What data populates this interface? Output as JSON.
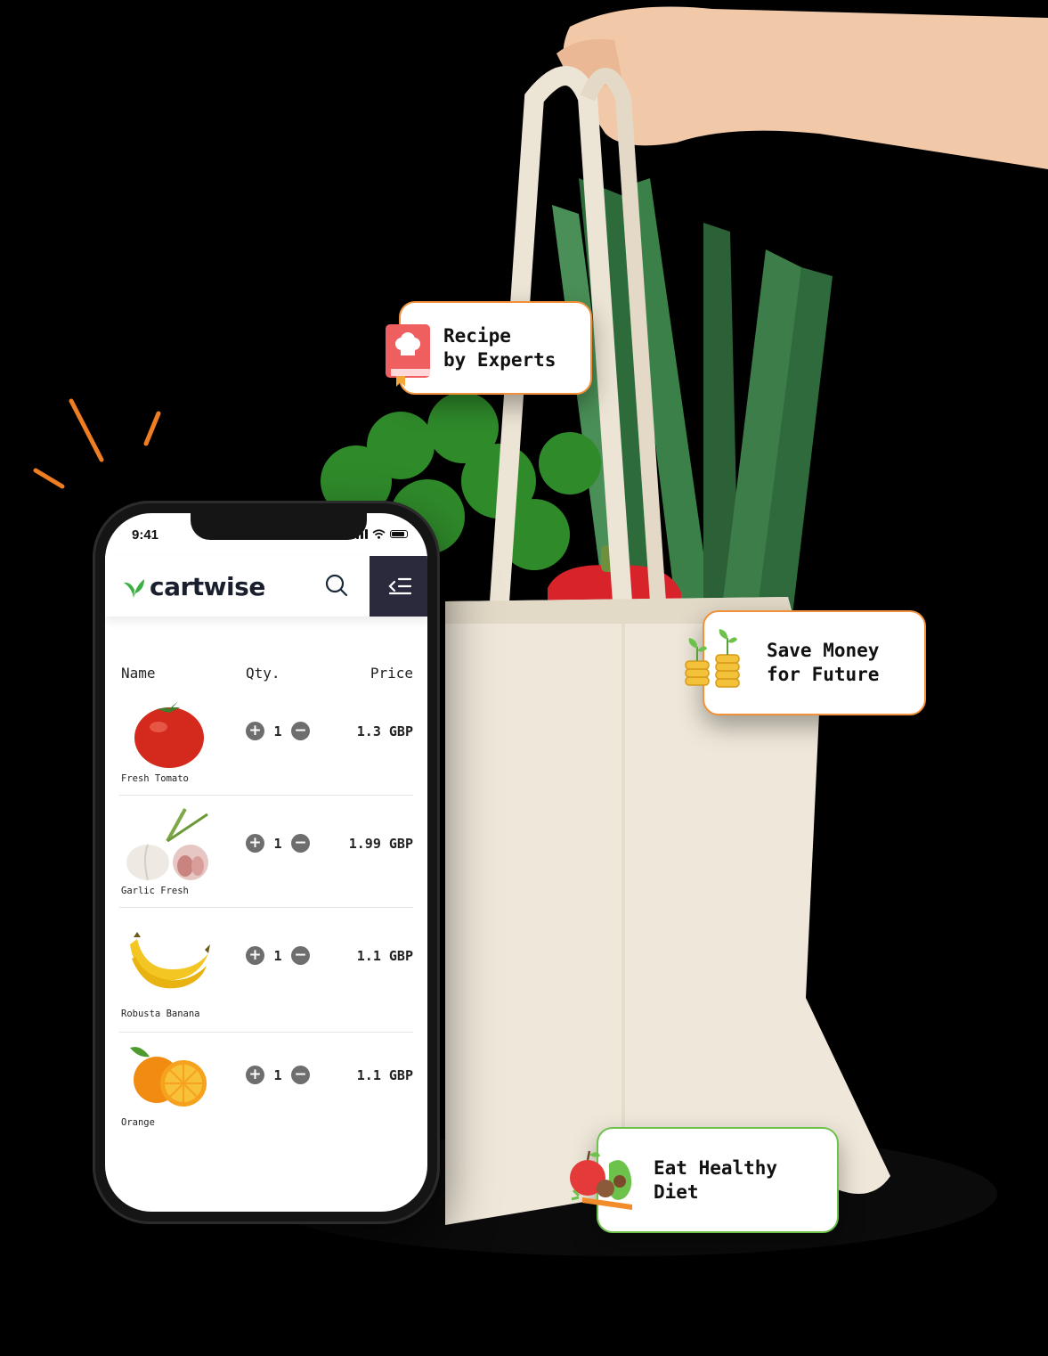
{
  "status_bar": {
    "time": "9:41"
  },
  "app": {
    "brand": "cartwise",
    "colors": {
      "brand_green": "#3cb043",
      "menu_bg": "#2b2a3d",
      "accent_orange": "#f2913a",
      "accent_green": "#6cc24a"
    },
    "icons": {
      "search": "search-icon",
      "menu": "menu-collapse-icon",
      "logo": "leaf-logo-icon"
    }
  },
  "cart_table": {
    "headers": {
      "name": "Name",
      "qty": "Qty.",
      "price": "Price"
    },
    "items": [
      {
        "name": "Fresh Tomato",
        "qty": "1",
        "price": "1.3 GBP",
        "icon": "tomato"
      },
      {
        "name": "Garlic Fresh",
        "qty": "1",
        "price": "1.99 GBP",
        "icon": "garlic"
      },
      {
        "name": "Robusta Banana",
        "qty": "1",
        "price": "1.1 GBP",
        "icon": "banana"
      },
      {
        "name": "Orange",
        "qty": "1",
        "price": "1.1 GBP",
        "icon": "orange"
      }
    ],
    "increment_symbol": "+",
    "decrement_symbol": "−"
  },
  "badges": {
    "recipe": {
      "line1": "Recipe",
      "line2": "by Experts",
      "icon": "recipe-book-icon"
    },
    "money": {
      "line1": "Save Money",
      "line2": "for Future",
      "icon": "coins-sprout-icon"
    },
    "diet": {
      "line1": "Eat Healthy",
      "line2": "Diet",
      "icon": "fruits-vegetables-icon"
    }
  }
}
